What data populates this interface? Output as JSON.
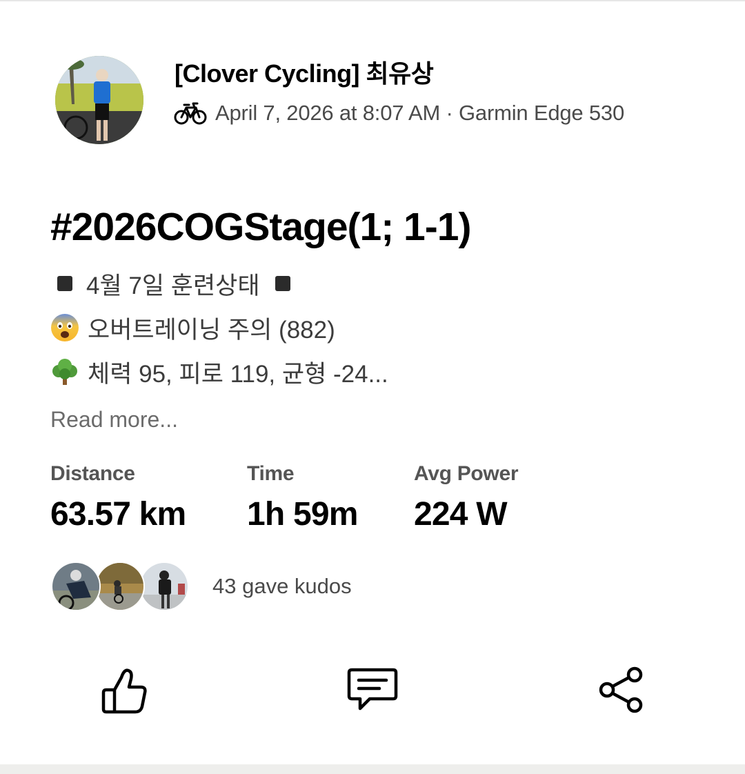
{
  "activity": {
    "athlete_name": "[Clover Cycling] 최유상",
    "meta": "April 7, 2026 at 8:07 AM · Garmin Edge 530",
    "activity_icon": "bike-icon",
    "title": "#2026COGStage(1; 1-1)",
    "description": {
      "line1": "4월 7일 훈련상태",
      "line2": "오버트레이닝 주의 (882)",
      "line3": "체력 95, 피로 119, 균형 -24..."
    },
    "read_more": "Read more...",
    "stats": [
      {
        "label": "Distance",
        "value": "63.57 km"
      },
      {
        "label": "Time",
        "value": "1h 59m"
      },
      {
        "label": "Avg Power",
        "value": "224 W"
      }
    ],
    "kudos_text": "43 gave kudos"
  },
  "actions": {
    "like_icon": "thumbs-up-icon",
    "comment_icon": "comment-icon",
    "share_icon": "share-icon"
  }
}
